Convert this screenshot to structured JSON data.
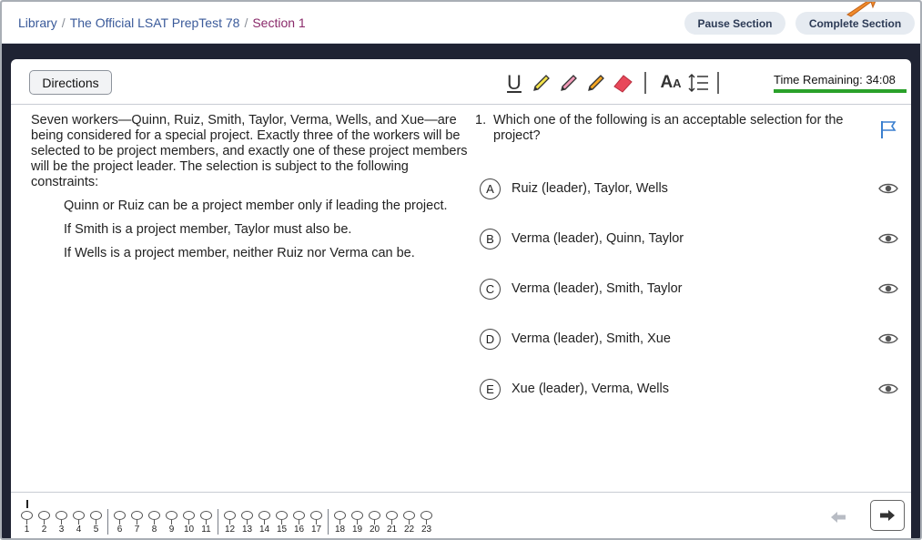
{
  "breadcrumb": {
    "library": "Library",
    "test": "The Official LSAT PrepTest 78",
    "section": "Section 1",
    "separator": "/"
  },
  "header": {
    "pause_label": "Pause Section",
    "complete_label": "Complete Section"
  },
  "toolbar": {
    "directions_label": "Directions",
    "underline_glyph": "U",
    "font_size_glyph_large": "A",
    "font_size_glyph_small": "A",
    "line_spacing_glyph": "↕☰",
    "timer_label": "Time Remaining: 34:08",
    "highlight_colors": [
      "#f3e34a",
      "#f29ab8",
      "#f5a623"
    ],
    "eraser_color": "#e8485a"
  },
  "passage": {
    "intro": "Seven workers—Quinn, Ruiz, Smith, Taylor, Verma, Wells, and Xue—are being considered for a special project. Exactly three of the workers will be selected to be project members, and exactly one of these project members will be the project leader. The selection is subject to the following constraints:",
    "constraints": [
      "Quinn or Ruiz can be a project member only if leading the project.",
      "If Smith is a project member, Taylor must also be.",
      "If Wells is a project member, neither Ruiz nor Verma can be."
    ]
  },
  "question": {
    "number": "1.",
    "text": "Which one of the following is an acceptable selection for the project?",
    "options": [
      {
        "letter": "A",
        "text": "Ruiz (leader), Taylor, Wells"
      },
      {
        "letter": "B",
        "text": "Verma (leader), Quinn, Taylor"
      },
      {
        "letter": "C",
        "text": "Verma (leader), Smith, Taylor"
      },
      {
        "letter": "D",
        "text": "Verma (leader), Smith, Xue"
      },
      {
        "letter": "E",
        "text": "Xue (leader), Verma, Wells"
      }
    ]
  },
  "navigation": {
    "question_groups": [
      [
        "1",
        "2",
        "3",
        "4",
        "5"
      ],
      [
        "6",
        "7",
        "8",
        "9",
        "10",
        "11"
      ],
      [
        "12",
        "13",
        "14",
        "15",
        "16",
        "17"
      ],
      [
        "18",
        "19",
        "20",
        "21",
        "22",
        "23"
      ]
    ],
    "current_question": "1",
    "accent_color": "#2aa12a"
  }
}
